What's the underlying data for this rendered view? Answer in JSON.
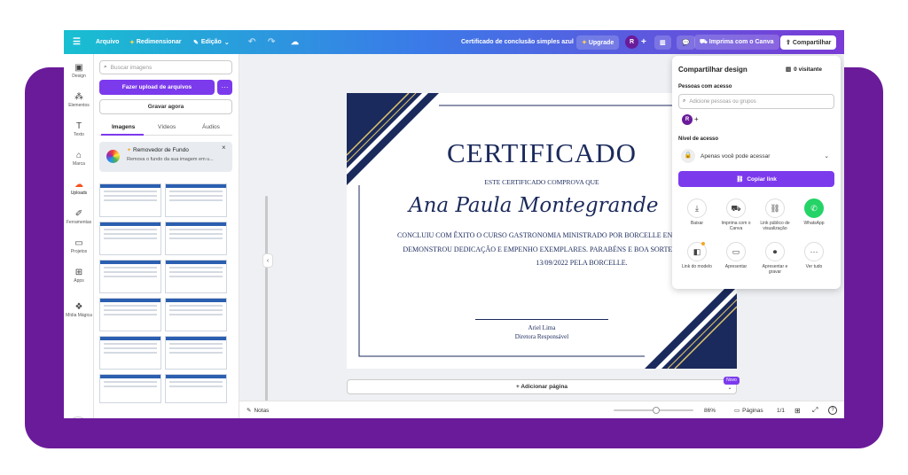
{
  "topbar": {
    "menu_icon": "hamburger-icon",
    "arquivo": "Arquivo",
    "redimensionar": "Redimensionar",
    "edicao": "Edição",
    "doc_title": "Certificado de conclusão simples azul",
    "upgrade": "Upgrade",
    "avatar": "R",
    "imprima": "Imprima com o Canva",
    "compartilhar": "Compartilhar"
  },
  "rail": {
    "items": [
      {
        "label": "Design",
        "icon": "layout-icon"
      },
      {
        "label": "Elementos",
        "icon": "shapes-icon"
      },
      {
        "label": "Texto",
        "icon": "text-icon"
      },
      {
        "label": "Marca",
        "icon": "brand-icon"
      },
      {
        "label": "Uploads",
        "icon": "cloud-upload-icon"
      },
      {
        "label": "Ferramentas",
        "icon": "tools-icon"
      },
      {
        "label": "Projetos",
        "icon": "folder-icon"
      },
      {
        "label": "Apps",
        "icon": "apps-icon"
      },
      {
        "label": "Mídia Mágica",
        "icon": "magic-media-icon"
      }
    ]
  },
  "panel": {
    "search_placeholder": "Buscar imagens",
    "upload_label": "Fazer upload de arquivos",
    "more": "···",
    "record_label": "Gravar agora",
    "tabs": [
      "Imagens",
      "Vídeos",
      "Áudios"
    ],
    "promo_title": "Removedor de Fundo",
    "promo_text": "Remova o fundo da sua imagem em u...",
    "promo_close": "×"
  },
  "certificate": {
    "title": "CERTIFICADO",
    "subtitle": "ESTE CERTIFICADO COMPROVA QUE",
    "name": "Ana Paula Montegrande",
    "body": "CONCLUIU COM ÊXITO O CURSO GASTRONOMIA MINISTRADO POR BORCELLE ENTRE 28/08/2019 E 28/08/2022 E DEMONSTROU DEDICAÇÃO E EMPENHO EXEMPLARES. PARABÉNS E BOA SORTE NO FUTURO. EMITIDO EM 13/09/2022 PELA BORCELLE.",
    "sig_name": "Ariel Lima",
    "sig_role": "Diretora Responsável"
  },
  "add_page": "+ Adicionar página",
  "novo_badge": "Novo",
  "bottombar": {
    "notas": "Notas",
    "zoom": "86%",
    "paginas": "Páginas",
    "page_count": "1/1",
    "help": "?"
  },
  "share_panel": {
    "title": "Compartilhar design",
    "visitors": "0 visitante",
    "people_label": "Pessoas com acesso",
    "people_placeholder": "Adicione pessoas ou grupos",
    "avatar": "R",
    "access_label": "Nível de acesso",
    "access_value": "Apenas você pode acessar",
    "copy_link": "Copiar link",
    "options": [
      {
        "label": "Baixar",
        "icon": "download-icon"
      },
      {
        "label": "Imprima com o Canva",
        "icon": "truck-icon"
      },
      {
        "label": "Link público de visualização",
        "icon": "link-icon"
      },
      {
        "label": "WhatsApp",
        "icon": "whatsapp-icon"
      },
      {
        "label": "Link do modelo",
        "icon": "template-icon"
      },
      {
        "label": "Apresentar",
        "icon": "present-icon"
      },
      {
        "label": "Apresentar e gravar",
        "icon": "record-icon"
      },
      {
        "label": "Ver tudo",
        "icon": "more-icon"
      }
    ]
  },
  "colors": {
    "accent": "#7c3aed",
    "navy": "#1b2a5c",
    "brand_purple": "#6a1b9a"
  }
}
